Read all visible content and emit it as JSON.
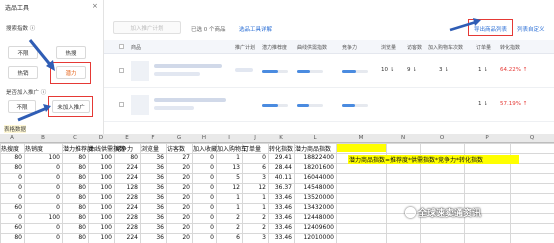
{
  "left_panel": {
    "title": "选品工具",
    "close": "×",
    "section1": "搜索指数 ⓘ",
    "section2": "是否加入推广 ⓘ",
    "section3": "表格数据",
    "btn_no1": "不限",
    "btn_hot": "热搜",
    "btn_hotsell": "热销",
    "btn_potential": "潜力",
    "btn_no2": "不限",
    "btn_notjoined": "未加入推广"
  },
  "toolbar": {
    "add_btn": "加入推广计划",
    "selected_text": "已选 0 个商品",
    "tutorial_link": "选品工具详解",
    "right_link1": "导出商品列表",
    "right_link2": "列表自定义"
  },
  "table": {
    "headers": [
      "商品",
      "推广计划",
      "潜力推荐度",
      "曲线供需指数",
      "竞争力",
      "浏览量",
      "访客数",
      "加入购物车次数",
      "订单量",
      "转化指数"
    ],
    "rows": [
      {
        "browse": "10 ⇂",
        "visits": "9 ⇂",
        "cart": "3 ⇂",
        "orders": "1 ⇂",
        "conv": "64.22% ↑"
      },
      {
        "browse": "",
        "visits": "",
        "cart": "",
        "orders": "1 ⇂",
        "conv": "57.19% ↑"
      }
    ]
  },
  "sheet": {
    "columns": [
      "A",
      "B",
      "C",
      "D",
      "E",
      "F",
      "G",
      "H",
      "I",
      "J",
      "K",
      "L",
      "M",
      "N",
      "O",
      "P",
      "Q"
    ],
    "headers": [
      "热搜度",
      "热销度",
      "潜力推荐度",
      "曲线供需指数",
      "竞争力",
      "浏览量",
      "访客数",
      "加入收藏",
      "加入购物车",
      "订单量",
      "转化指数",
      "潜力商品指数"
    ],
    "rows": [
      [
        "80",
        "100",
        "80",
        "100",
        "80",
        "36",
        "27",
        "0",
        "1",
        "0",
        "29.41",
        "18822400"
      ],
      [
        "80",
        "0",
        "80",
        "100",
        "224",
        "36",
        "20",
        "0",
        "13",
        "6",
        "28.44",
        "18201600"
      ],
      [
        "0",
        "0",
        "80",
        "100",
        "224",
        "36",
        "20",
        "0",
        "5",
        "3",
        "40.11",
        "16044000"
      ],
      [
        "0",
        "0",
        "80",
        "100",
        "128",
        "36",
        "20",
        "0",
        "12",
        "12",
        "36.37",
        "14548000"
      ],
      [
        "0",
        "0",
        "80",
        "100",
        "228",
        "36",
        "20",
        "0",
        "1",
        "1",
        "33.46",
        "13520000"
      ],
      [
        "60",
        "0",
        "80",
        "100",
        "224",
        "36",
        "20",
        "0",
        "1",
        "1",
        "33.46",
        "13432000"
      ],
      [
        "0",
        "100",
        "80",
        "100",
        "228",
        "36",
        "20",
        "0",
        "2",
        "2",
        "33.46",
        "12448000"
      ],
      [
        "60",
        "0",
        "80",
        "100",
        "228",
        "36",
        "20",
        "0",
        "2",
        "2",
        "33.46",
        "12409600"
      ],
      [
        "80",
        "0",
        "80",
        "100",
        "224",
        "36",
        "20",
        "0",
        "6",
        "3",
        "33.46",
        "12010000"
      ]
    ],
    "formula_note": "潜力商品指数=推荐度*供需指数*竞争力*转化指数",
    "watermark": "全球速卖通资讯"
  }
}
